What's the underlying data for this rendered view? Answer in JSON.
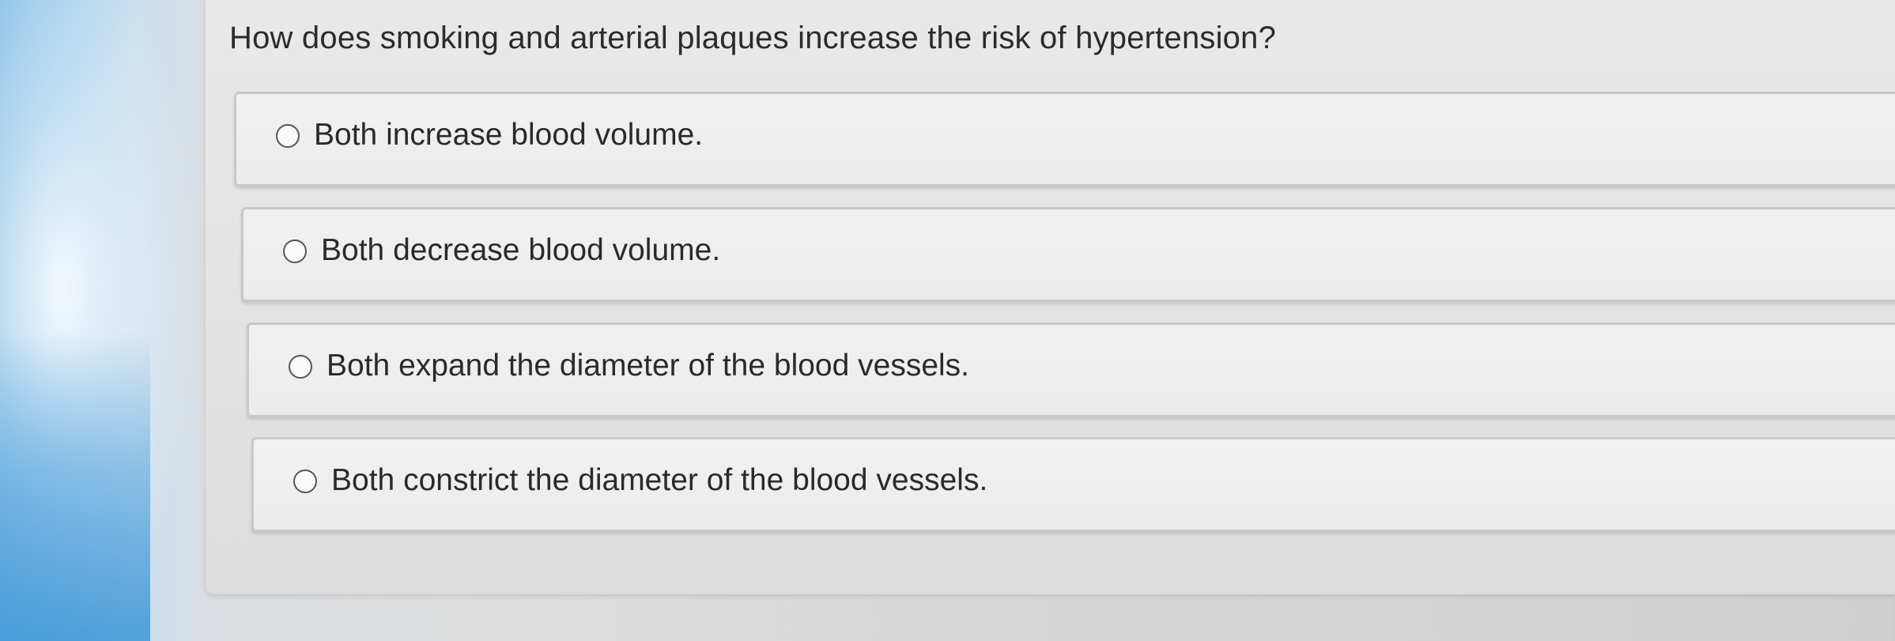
{
  "question": {
    "text": "How does smoking and arterial plaques increase the risk of hypertension?"
  },
  "options": [
    {
      "label": "Both increase blood volume.",
      "selected": false
    },
    {
      "label": "Both decrease blood volume.",
      "selected": false
    },
    {
      "label": "Both expand the diameter of the blood vessels.",
      "selected": false
    },
    {
      "label": "Both constrict the diameter of the blood vessels.",
      "selected": false
    }
  ],
  "colors": {
    "panel_background": "#e6e6e6",
    "option_background": "#eeeeee",
    "option_border": "#c9c9c9",
    "text": "#2b2b2b",
    "left_edge_blue": "#8ec4e8"
  }
}
